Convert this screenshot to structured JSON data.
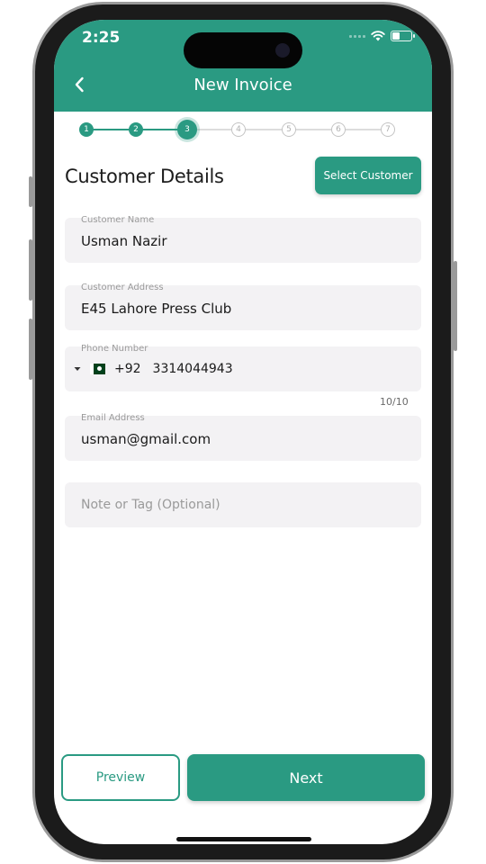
{
  "status_bar": {
    "time": "2:25"
  },
  "header": {
    "title": "New Invoice"
  },
  "stepper": {
    "steps": [
      "1",
      "2",
      "3",
      "4",
      "5",
      "6",
      "7"
    ],
    "current_step": 3
  },
  "section": {
    "title": "Customer Details",
    "select_button": "Select Customer"
  },
  "form": {
    "customer_name": {
      "label": "Customer Name",
      "value": "Usman Nazir"
    },
    "customer_address": {
      "label": "Customer Address",
      "value": "E45 Lahore Press Club"
    },
    "phone": {
      "label": "Phone Number",
      "country_code": "+92",
      "value": "3314044943",
      "counter": "10/10"
    },
    "email": {
      "label": "Email Address",
      "value": "usman@gmail.com"
    },
    "note": {
      "placeholder": "Note or Tag (Optional)"
    }
  },
  "actions": {
    "preview": "Preview",
    "next": "Next"
  },
  "colors": {
    "primary": "#2a9a82",
    "field_bg": "#f3f2f4"
  },
  "icons": {
    "back": "chevron-left-icon",
    "wifi": "wifi-icon",
    "battery": "battery-icon",
    "dropdown": "caret-down-icon",
    "flag": "pakistan-flag-icon"
  }
}
